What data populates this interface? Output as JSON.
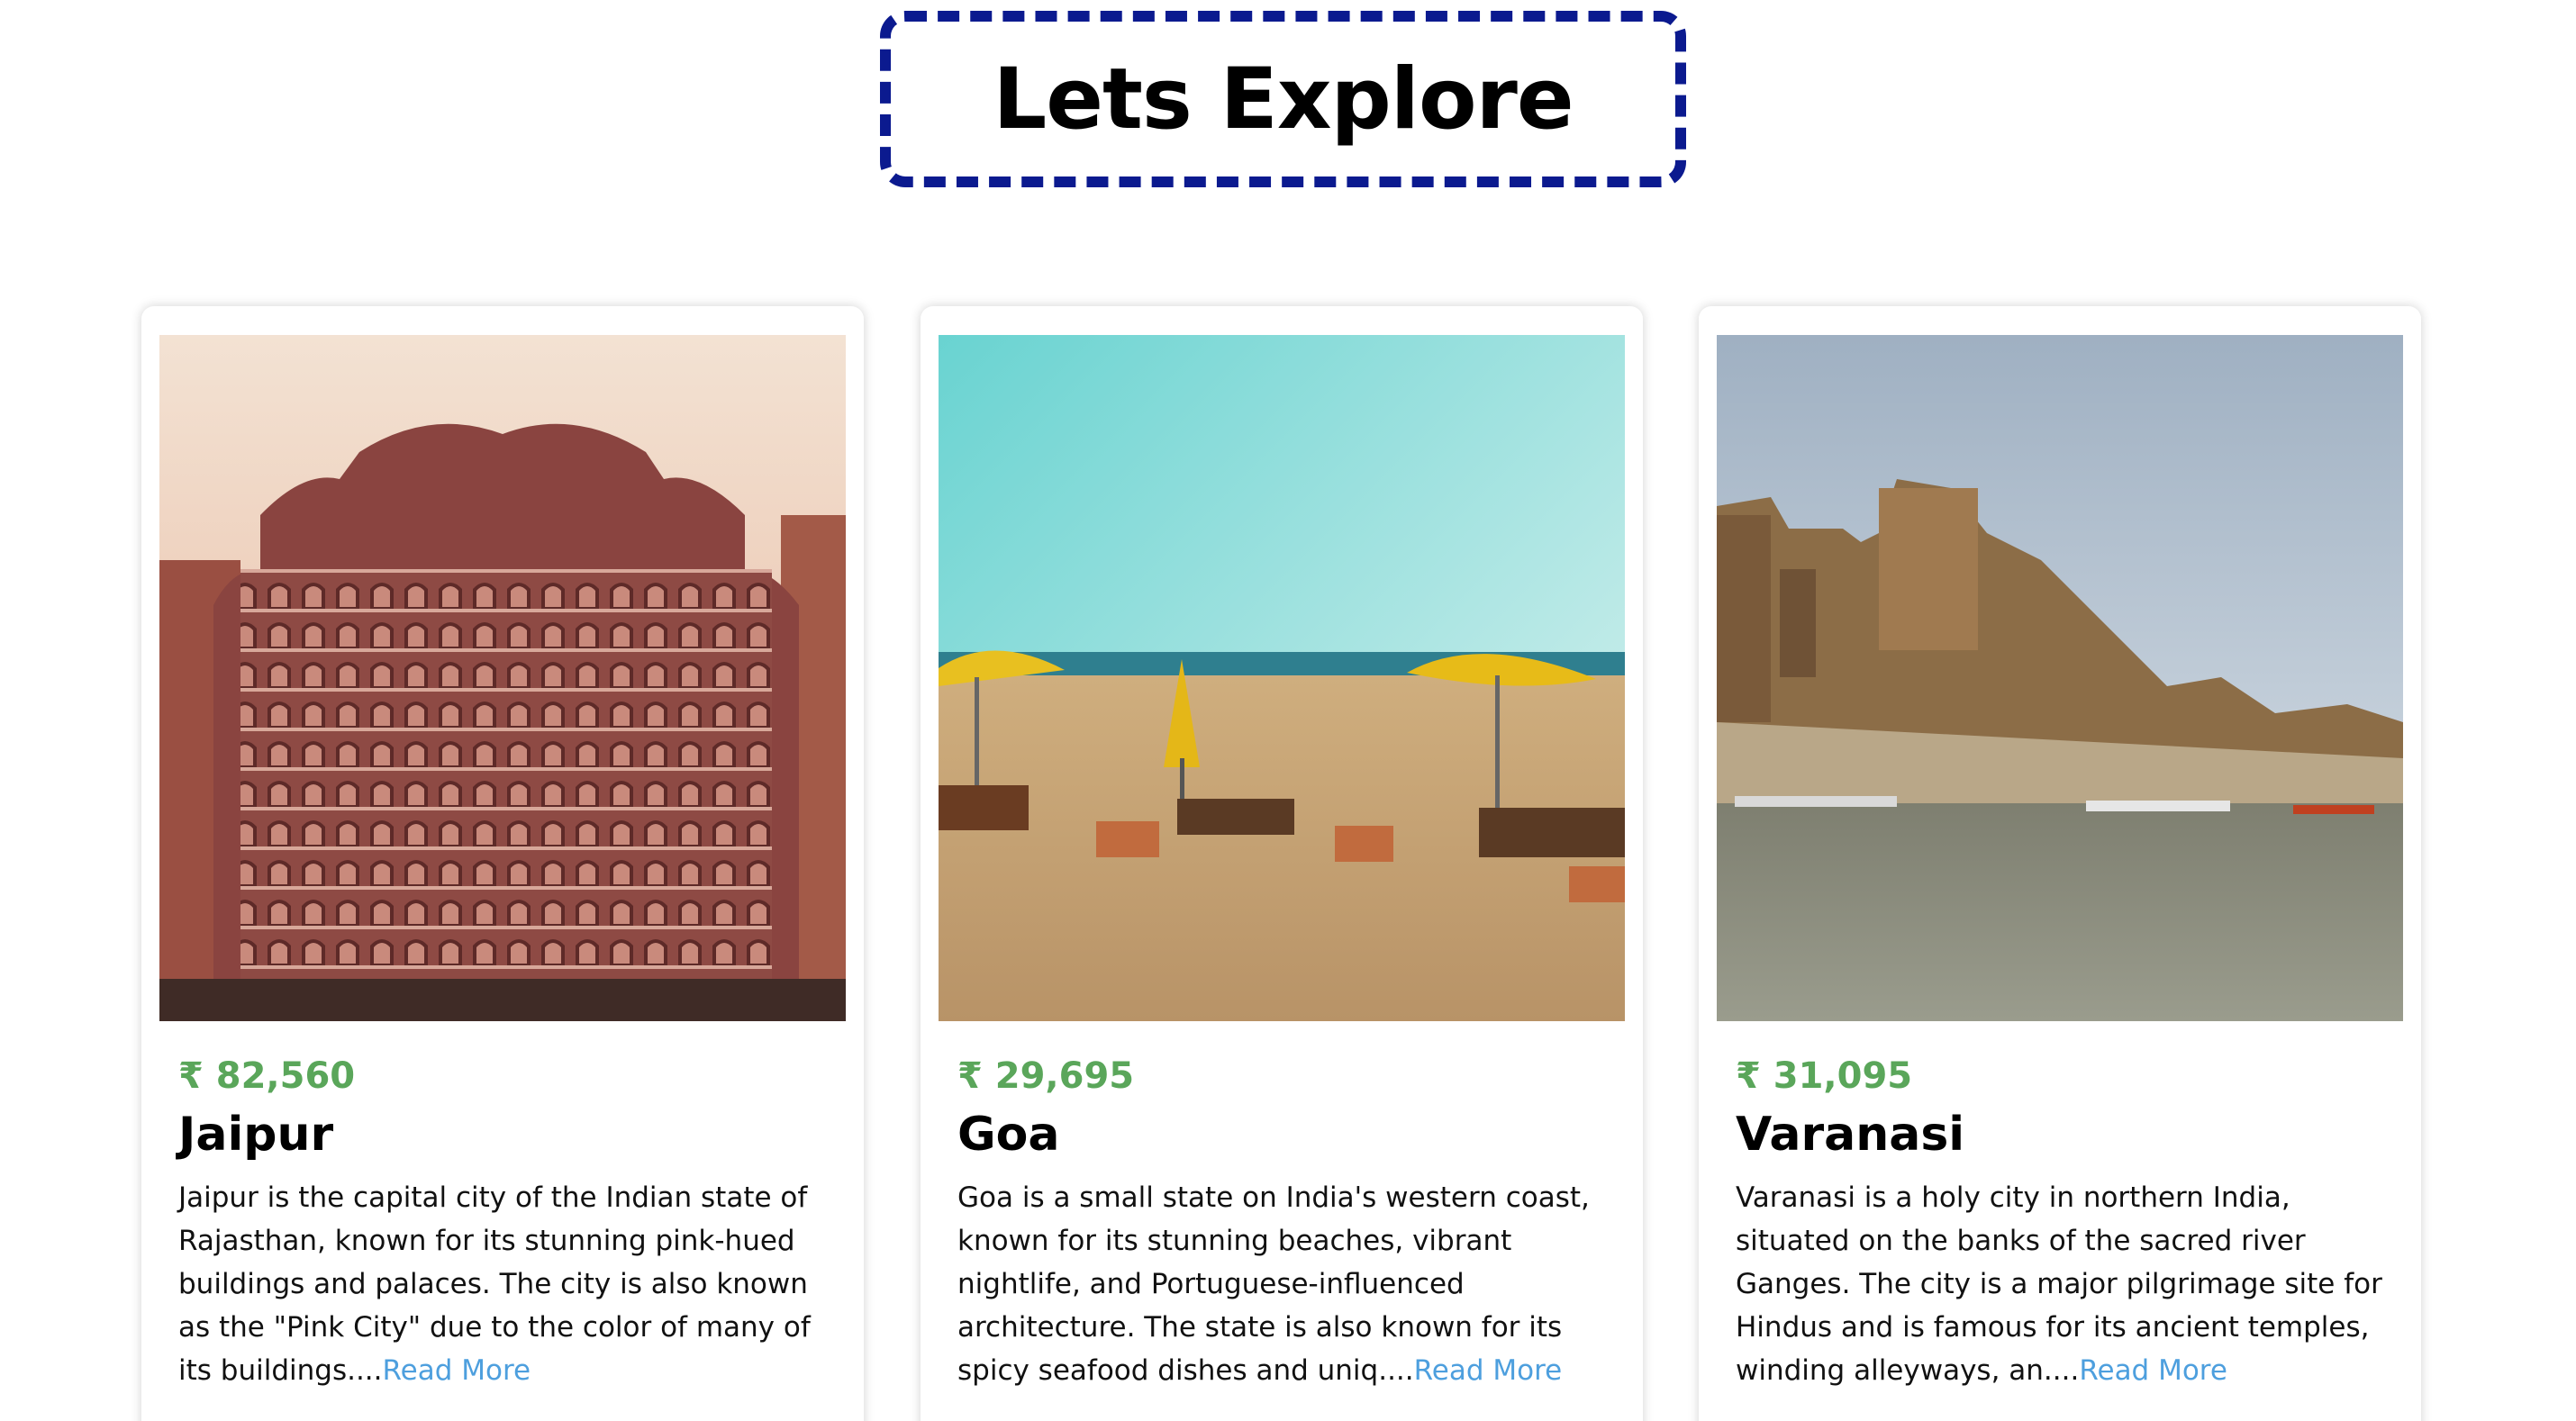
{
  "header": {
    "title": "Lets Explore"
  },
  "destinations": [
    {
      "price": "₹ 82,560",
      "city": "Jaipur",
      "description": "Jaipur is the capital city of the Indian state of Rajasthan, known for its stunning pink-hued buildings and palaces. The city is also known as the \"Pink City\" due to the color of many of its buildings....",
      "read_more": "Read More"
    },
    {
      "price": "₹ 29,695",
      "city": "Goa",
      "description": "Goa is a small state on India's western coast, known for its stunning beaches, vibrant nightlife, and Portuguese-influenced architecture. The state is also known for its spicy seafood dishes and uniq....",
      "read_more": "Read More"
    },
    {
      "price": "₹ 31,095",
      "city": "Varanasi",
      "description": "Varanasi is a holy city in northern India, situated on the banks of the sacred river Ganges. The city is a major pilgrimage site for Hindus and is famous for its ancient temples, winding alleyways, an....",
      "read_more": "Read More"
    }
  ],
  "colors": {
    "title_border": "#0b1a8f",
    "price": "#5aa65a",
    "link": "#4d9fde"
  }
}
